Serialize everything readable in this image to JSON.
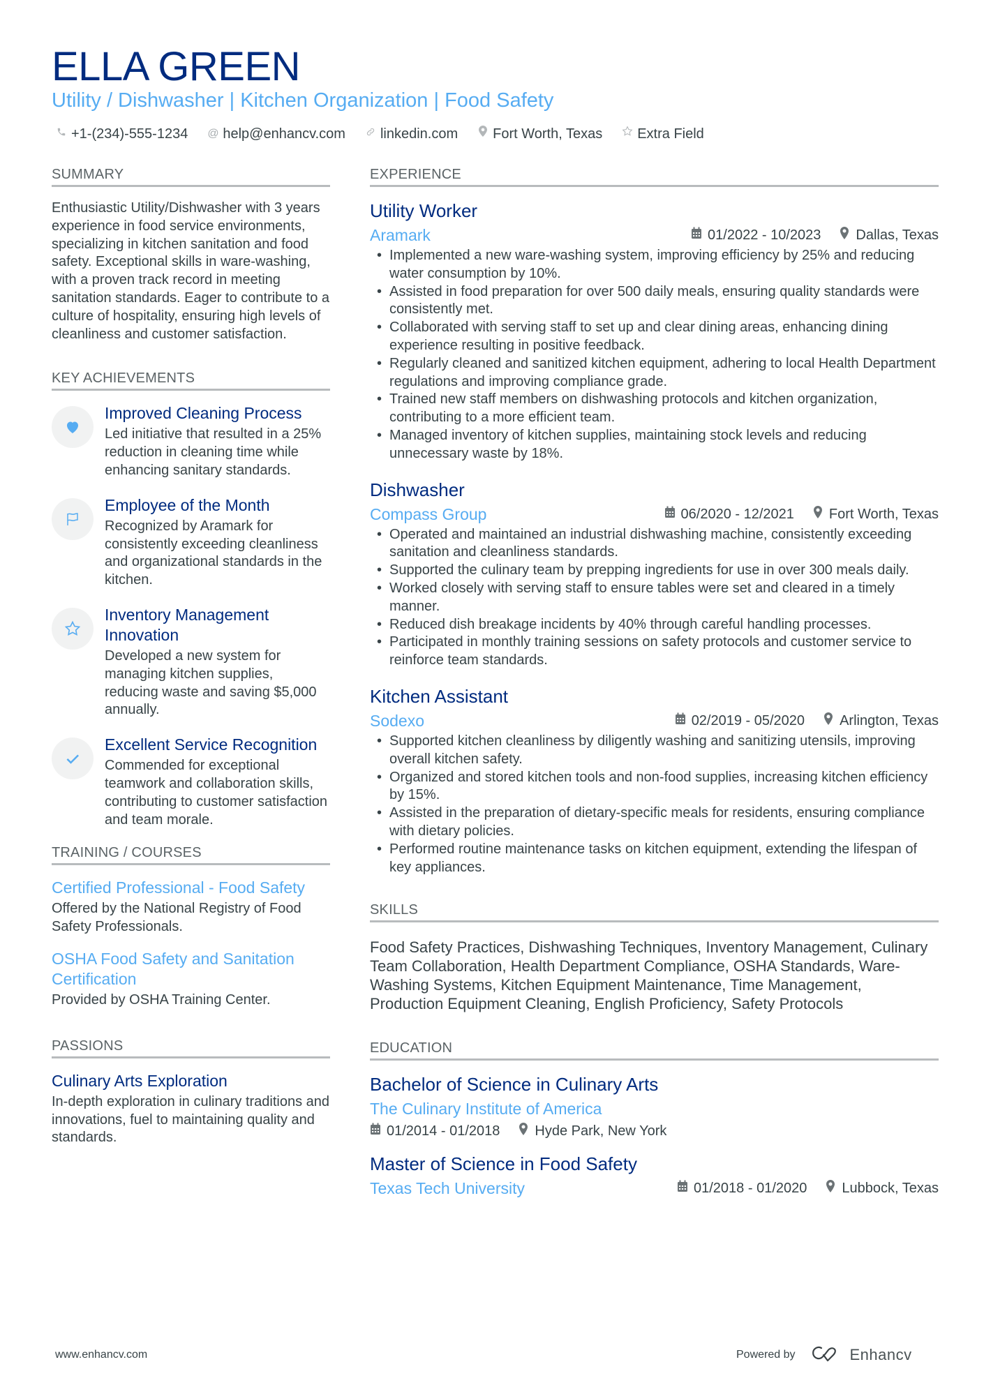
{
  "header": {
    "name": "ELLA GREEN",
    "headline": "Utility / Dishwasher | Kitchen Organization | Food Safety",
    "contacts": [
      {
        "icon": "phone-icon",
        "text": "+1-(234)-555-1234"
      },
      {
        "icon": "at-icon",
        "text": "help@enhancv.com"
      },
      {
        "icon": "link-icon",
        "text": "linkedin.com"
      },
      {
        "icon": "location-icon",
        "text": "Fort Worth, Texas"
      },
      {
        "icon": "star-icon",
        "text": "Extra Field"
      }
    ]
  },
  "colors": {
    "name": "#002b7f",
    "accent": "#56acf2",
    "text": "#384347",
    "section_rule": "#b8bbbd",
    "icon_bg": "#f1f2f2"
  },
  "summary": {
    "title": "Summary",
    "text": "Enthusiastic Utility/Dishwasher with 3 years experience in food service environments, specializing in kitchen sanitation and food safety. Exceptional skills in ware-washing, with a proven track record in meeting sanitation standards. Eager to contribute to a culture of hospitality, ensuring high levels of cleanliness and customer satisfaction."
  },
  "achievements": {
    "title": "Key Achievements",
    "items": [
      {
        "icon": "heart-icon",
        "title": "Improved Cleaning Process",
        "desc": "Led initiative that resulted in a 25% reduction in cleaning time while enhancing sanitary standards."
      },
      {
        "icon": "flag-icon",
        "title": "Employee of the Month",
        "desc": "Recognized by Aramark for consistently exceeding cleanliness and organizational standards in the kitchen."
      },
      {
        "icon": "star-icon",
        "title": "Inventory Management Innovation",
        "desc": "Developed a new system for managing kitchen supplies, reducing waste and saving $5,000 annually."
      },
      {
        "icon": "check-icon",
        "title": "Excellent Service Recognition",
        "desc": "Commended for exceptional teamwork and collaboration skills, contributing to customer satisfaction and team morale."
      }
    ]
  },
  "training": {
    "title": "Training / Courses",
    "items": [
      {
        "title": "Certified Professional - Food Safety",
        "desc": "Offered by the National Registry of Food Safety Professionals."
      },
      {
        "title": "OSHA Food Safety and Sanitation Certification",
        "desc": "Provided by OSHA Training Center."
      }
    ]
  },
  "passions": {
    "title": "Passions",
    "items": [
      {
        "title": "Culinary Arts Exploration",
        "desc": "In-depth exploration in culinary traditions and innovations, fuel to maintaining quality and standards."
      }
    ]
  },
  "experience": {
    "title": "Experience",
    "jobs": [
      {
        "title": "Utility Worker",
        "company": "Aramark",
        "dates": "01/2022 - 10/2023",
        "location": "Dallas, Texas",
        "bullets": [
          "Implemented a new ware-washing system, improving efficiency by 25% and reducing water consumption by 10%.",
          "Assisted in food preparation for over 500 daily meals, ensuring quality standards were consistently met.",
          "Collaborated with serving staff to set up and clear dining areas, enhancing dining experience resulting in positive feedback.",
          "Regularly cleaned and sanitized kitchen equipment, adhering to local Health Department regulations and improving compliance grade.",
          "Trained new staff members on dishwashing protocols and kitchen organization, contributing to a more efficient team.",
          "Managed inventory of kitchen supplies, maintaining stock levels and reducing unnecessary waste by 18%."
        ]
      },
      {
        "title": "Dishwasher",
        "company": "Compass Group",
        "dates": "06/2020 - 12/2021",
        "location": "Fort Worth, Texas",
        "bullets": [
          "Operated and maintained an industrial dishwashing machine, consistently exceeding sanitation and cleanliness standards.",
          "Supported the culinary team by prepping ingredients for use in over 300 meals daily.",
          "Worked closely with serving staff to ensure tables were set and cleared in a timely manner.",
          "Reduced dish breakage incidents by 40% through careful handling processes.",
          "Participated in monthly training sessions on safety protocols and customer service to reinforce team standards."
        ]
      },
      {
        "title": "Kitchen Assistant",
        "company": "Sodexo",
        "dates": "02/2019 - 05/2020",
        "location": "Arlington, Texas",
        "bullets": [
          "Supported kitchen cleanliness by diligently washing and sanitizing utensils, improving overall kitchen safety.",
          "Organized and stored kitchen tools and non-food supplies, increasing kitchen efficiency by 15%.",
          "Assisted in the preparation of dietary-specific meals for residents, ensuring compliance with dietary policies.",
          "Performed routine maintenance tasks on kitchen equipment, extending the lifespan of key appliances."
        ]
      }
    ]
  },
  "skills": {
    "title": "Skills",
    "text": "Food Safety Practices, Dishwashing Techniques, Inventory Management, Culinary Team Collaboration, Health Department Compliance, OSHA Standards, Ware-Washing Systems, Kitchen Equipment Maintenance, Time Management, Production Equipment Cleaning, English Proficiency, Safety Protocols"
  },
  "education": {
    "title": "Education",
    "items": [
      {
        "degree": "Bachelor of Science in Culinary Arts",
        "school": "The Culinary Institute of America",
        "dates": "01/2014 - 01/2018",
        "location": "Hyde Park, New York"
      },
      {
        "degree": "Master of Science in Food Safety",
        "school": "Texas Tech University",
        "dates": "01/2018 - 01/2020",
        "location": "Lubbock, Texas"
      }
    ]
  },
  "footer": {
    "website": "www.enhancv.com",
    "powered_by": "Powered by",
    "brand": "Enhancv"
  }
}
